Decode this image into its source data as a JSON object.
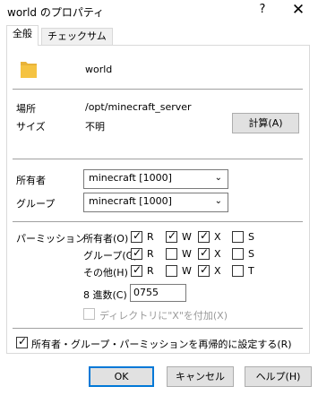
{
  "window": {
    "title": "world のプロパティ",
    "help_glyph": "?",
    "close_glyph": "✕"
  },
  "tabs": [
    {
      "label": "全般",
      "active": true
    },
    {
      "label": "チェックサム",
      "active": false
    }
  ],
  "general": {
    "name": "world",
    "location_label": "場所",
    "location_value": "/opt/minecraft_server",
    "size_label": "サイズ",
    "size_value": "不明",
    "calculate_button": "計算(A)",
    "owner_label": "所有者",
    "owner_value": "minecraft [1000]",
    "group_label": "グループ",
    "group_value": "minecraft [1000]",
    "permissions_label": "パーミッション",
    "permissions": {
      "rows": [
        {
          "label": "所有者(O)",
          "R": true,
          "W": true,
          "X": true,
          "S": false,
          "last": "S"
        },
        {
          "label": "グループ(G)",
          "R": true,
          "W": false,
          "X": true,
          "S": false,
          "last": "S"
        },
        {
          "label": "その他(H)",
          "R": true,
          "W": false,
          "X": true,
          "S": false,
          "last": "T"
        }
      ],
      "col_labels": [
        "R",
        "W",
        "X"
      ],
      "octal_label": "8 進数(C)",
      "octal_value": "0755",
      "dir_x_label": "ディレクトリに\"X\"を付加(X)",
      "dir_x_checked": false,
      "dir_x_enabled": false
    },
    "recursive_label": "所有者・グループ・パーミッションを再帰的に設定する(R)",
    "recursive_checked": true
  },
  "footer": {
    "ok": "OK",
    "cancel": "キャンセル",
    "help": "ヘルプ(H)"
  },
  "colors": {
    "accent": "#0078d7",
    "folder": "#f5c342"
  }
}
